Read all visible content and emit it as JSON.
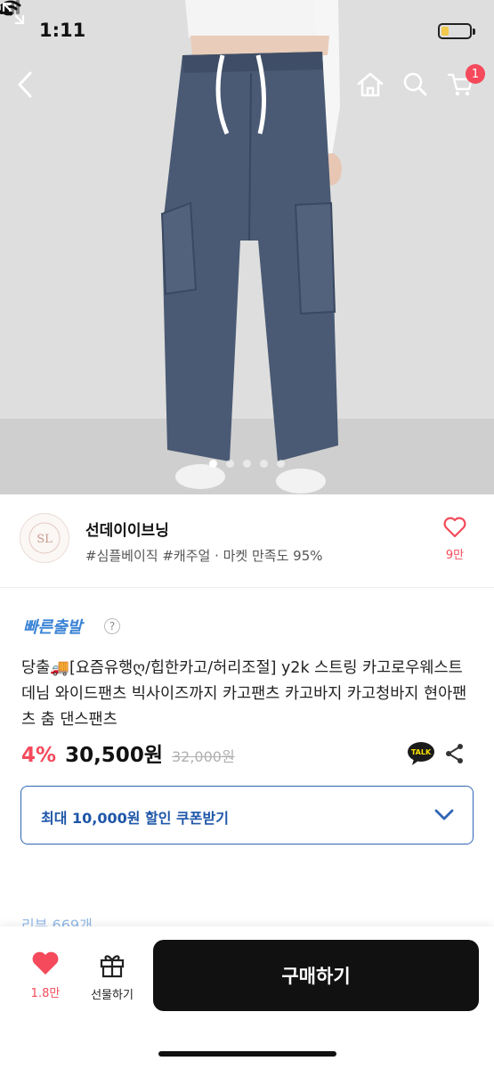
{
  "status_bar": {
    "time": "1:11"
  },
  "nav": {
    "cart_badge": "1"
  },
  "gallery": {
    "image_count": 5,
    "active_index": 0
  },
  "shop": {
    "logo_text": "SL",
    "name": "선데이이브닝",
    "tags": "#심플베이직 #캐주얼 · 마켓 만족도 95%",
    "like_count": "9만"
  },
  "product": {
    "fast_shipping_label": "빠른출발",
    "help_icon": "?",
    "title": "당출🚚[요즘유행ღ/힙한카고/허리조절] y2k 스트링 카고로우웨스트 데님 와이드팬츠 빅사이즈까지 카고팬츠 카고바지 카고청바지 현아팬츠 춤 댄스팬츠",
    "discount": "4%",
    "price": "30,500원",
    "original_price": "32,000원",
    "talk_label": "TALK"
  },
  "coupon": {
    "label": "최대 10,000원 할인 쿠폰받기"
  },
  "reviews": {
    "peek": "리뷰 669개"
  },
  "bottom_bar": {
    "like_count": "1.8만",
    "gift_label": "선물하기",
    "buy_label": "구매하기"
  },
  "colors": {
    "accent_red": "#f44a5b",
    "accent_blue": "#2f65b4",
    "buy_button": "#111111"
  }
}
